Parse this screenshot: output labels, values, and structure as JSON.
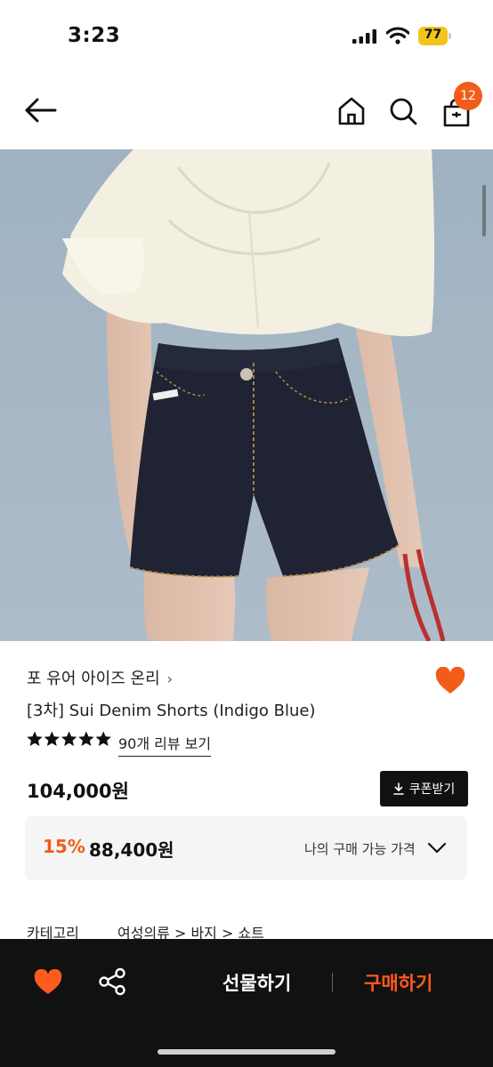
{
  "status_bar": {
    "time": "3:23",
    "battery_level": "77"
  },
  "header": {
    "cart_count": "12"
  },
  "product": {
    "brand": "포 유어 아이즈 온리",
    "title": "[3차] Sui Denim Shorts (Indigo Blue)",
    "rating_stars": 5,
    "review_link": "90개 리뷰 보기",
    "price": "104,000원",
    "coupon_label": "쿠폰받기",
    "discount_percent": "15%",
    "discount_price": "88,400원",
    "my_price_label": "나의 구매 가능 가격",
    "category_label": "카테고리",
    "category_path": "여성의류 > 바지 > 쇼트"
  },
  "bottom_bar": {
    "gift_label": "선물하기",
    "buy_label": "구매하기"
  },
  "colors": {
    "accent": "#f25c19",
    "dark": "#111111",
    "battery": "#f1c51b"
  }
}
